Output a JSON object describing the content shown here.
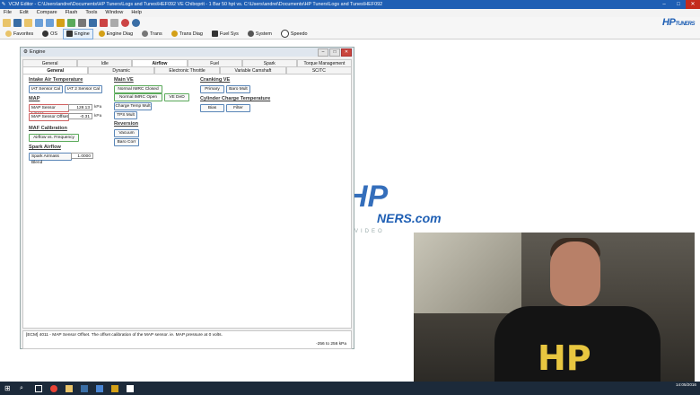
{
  "titlebar": {
    "text": "VCM Editor - C:\\Users\\andrei\\Documents\\HP Tuners\\Logs and Tunes\\HEF092 VE Chiboprit - 1 Bar 50 hpt vs. C:\\Users\\andrei\\Documents\\HP Tuners\\Logs and Tunes\\HEF092"
  },
  "menu": [
    "File",
    "Edit",
    "Compare",
    "Flash",
    "Tools",
    "Window",
    "Help"
  ],
  "toolbar2": [
    {
      "label": "Favorites",
      "active": false
    },
    {
      "label": "OS",
      "active": false
    },
    {
      "label": "Engine",
      "active": true
    },
    {
      "label": "Engine Diag",
      "active": false
    },
    {
      "label": "Trans",
      "active": false
    },
    {
      "label": "Trans Diag",
      "active": false
    },
    {
      "label": "Fuel Sys",
      "active": false
    },
    {
      "label": "System",
      "active": false
    },
    {
      "label": "Speedo",
      "active": false
    }
  ],
  "logo": {
    "main": "HP",
    "suffix": "TUNERS"
  },
  "engine_window": {
    "title": "Engine",
    "tabs_top": [
      "General",
      "Idle",
      "Airflow",
      "Fuel",
      "Spark",
      "Torque Management"
    ],
    "tabs_active_top": "Airflow",
    "tabs_sub": [
      "General",
      "Dynamic",
      "Electronic Throttle",
      "Variable Camshaft",
      "SC/TC"
    ],
    "tabs_active_sub": "General",
    "sections": {
      "intake_air_temp": {
        "heading": "Intake Air Temperature",
        "btn1": "IAT Sensor Cal",
        "btn2": "IAT 2 Sensor Cal"
      },
      "map": {
        "heading": "MAP",
        "linear_label": "MAP Sensor Linear",
        "linear_value": "128.13",
        "linear_unit": "kPa",
        "offset_label": "MAP Sensor Offset",
        "offset_value": "-0.31",
        "offset_unit": "kPa"
      },
      "map_cal": {
        "heading": "MAF Calibration",
        "btn": "Airflow vs. Frequency"
      },
      "spark_airflow": {
        "heading": "Spark Airflow",
        "label": "Spark Airmass Blend",
        "value": "1.0000"
      },
      "main_ve": {
        "heading": "Main VE",
        "btn1": "Normal IMRC Closed",
        "btn2": "Normal IMRC Open",
        "btn3": "VE DeD",
        "btn4": "Charge Temp Mult",
        "btn5": "TPS Mult"
      },
      "reversion": {
        "heading": "Reversion",
        "btn1": "Vacuum",
        "btn2": "Baro Corr"
      },
      "cranking_ve": {
        "heading": "Cranking VE",
        "btn1": "Primary",
        "btn2": "Baro Mult"
      },
      "cyl_charge_temp": {
        "heading": "Cylinder Charge Temperature",
        "btn1": "Bias",
        "btn2": "Filter"
      }
    },
    "status": {
      "description": "[ECM] 4011 - MAP Sensor Offset. The offset calibration of the MAP sensor. ie. MAP pressure at 0 volts.",
      "range": "-256 to 256 kPa"
    }
  },
  "watermark": {
    "main": "HP",
    "sub": "NERS.com",
    "tag": "VIDEO"
  },
  "tray": {
    "time": "14:05/2016"
  }
}
